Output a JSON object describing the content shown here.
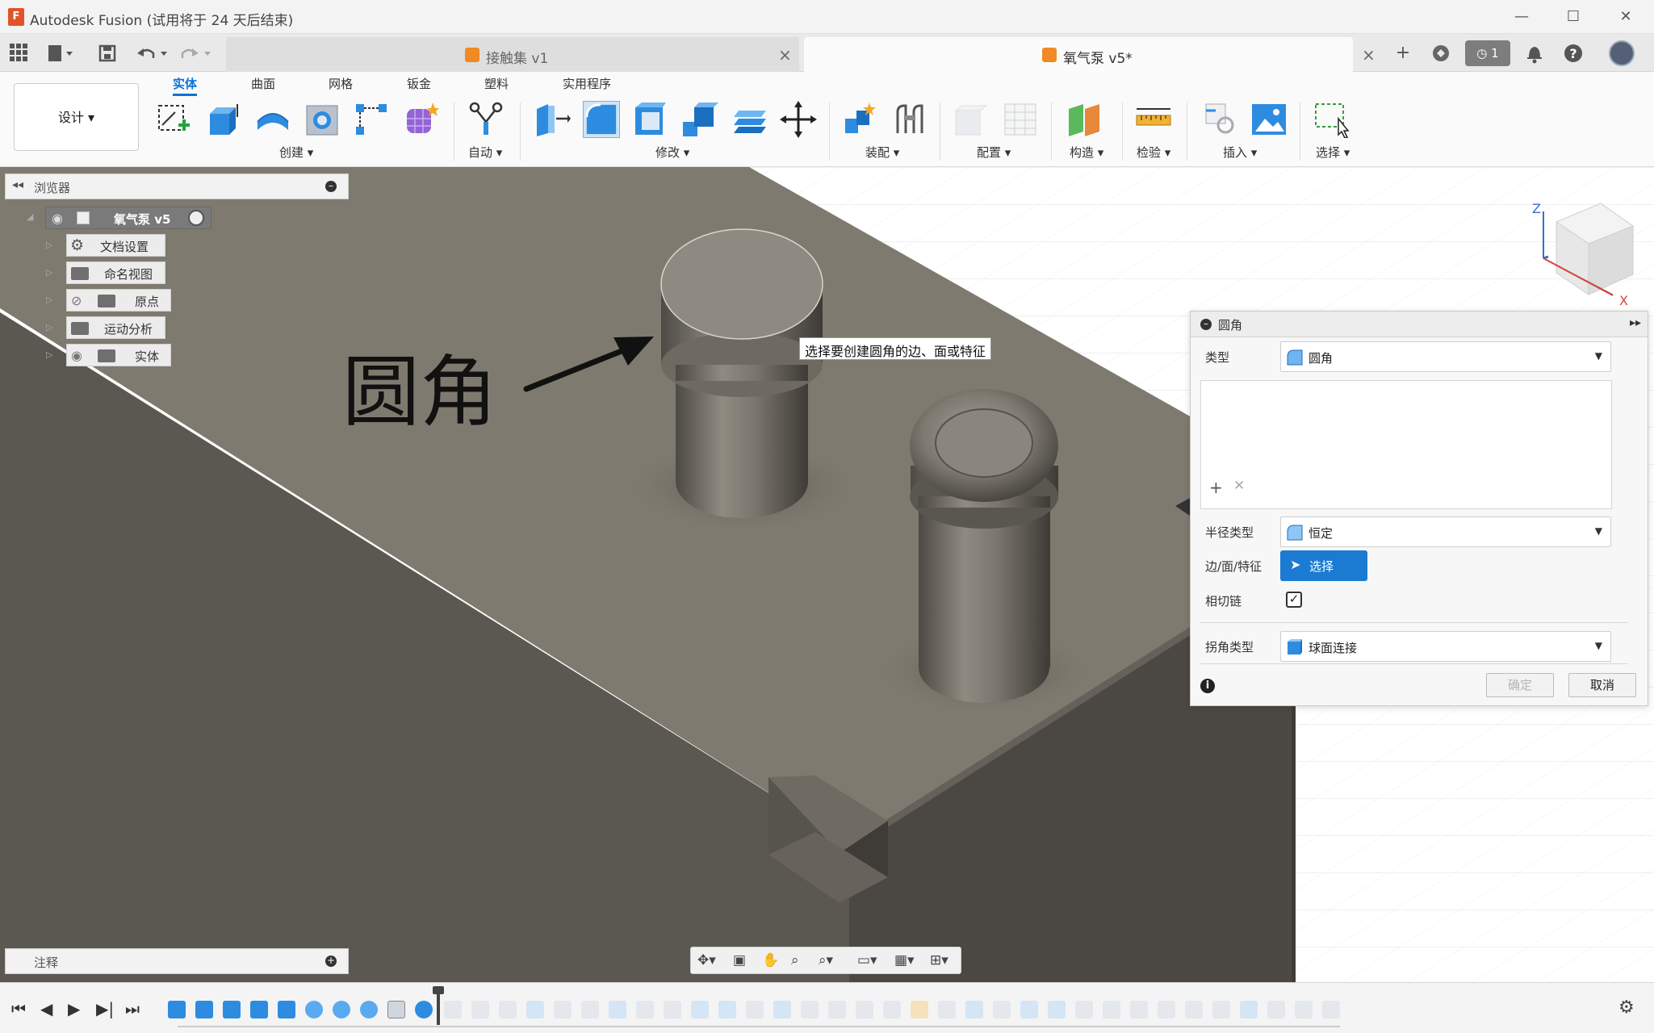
{
  "window": {
    "title": "Autodesk Fusion (试用将于 24 天后结束)",
    "logo": "F",
    "controls": [
      "—",
      "☐",
      "✕"
    ]
  },
  "tabs": [
    {
      "label": "接触集 v1",
      "active": false
    },
    {
      "label": "氧气泵 v5*",
      "active": true
    }
  ],
  "topbar": {
    "jobs_count": "1"
  },
  "ribbon": {
    "workspace": "设计 ▾",
    "tabs": [
      "实体",
      "曲面",
      "网格",
      "钣金",
      "塑料",
      "实用程序"
    ],
    "active_tab": "实体",
    "groups": [
      "创建 ▾",
      "自动 ▾",
      "修改 ▾",
      "装配 ▾",
      "配置 ▾",
      "构造 ▾",
      "检验 ▾",
      "插入 ▾",
      "选择 ▾"
    ]
  },
  "browser": {
    "title": "浏览器",
    "root": "氧气泵 v5",
    "items": [
      "文档设置",
      "命名视图",
      "原点",
      "运动分析",
      "实体"
    ]
  },
  "annotation": {
    "text": "圆角",
    "tooltip": "选择要创建圆角的边、面或特征"
  },
  "viewcube": {
    "axis_z": "Z",
    "axis_x": "X"
  },
  "dialog": {
    "title": "圆角",
    "type_label": "类型",
    "type_value": "圆角",
    "list_add": "+",
    "list_remove": "✕",
    "radius_type_label": "半径类型",
    "radius_type_value": "恒定",
    "edges_label": "边/面/特征",
    "select_button": "选择",
    "tangent_chain_label": "相切链",
    "tangent_chain_checked": true,
    "corner_type_label": "拐角类型",
    "corner_type_value": "球面连接",
    "ok_button": "确定",
    "cancel_button": "取消",
    "info_icon": "i"
  },
  "comments": {
    "title": "注释"
  },
  "colors": {
    "accent": "#0b73d6",
    "select_button": "#1b7bd3",
    "body_top": "#7f7a6f",
    "body_side": "#5e5a52"
  }
}
